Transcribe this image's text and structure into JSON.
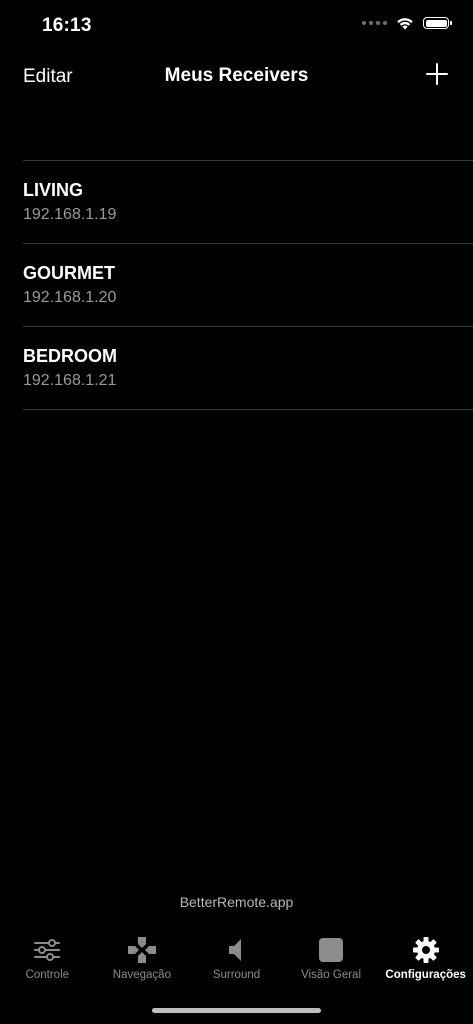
{
  "status_bar": {
    "time": "16:13"
  },
  "nav": {
    "edit_label": "Editar",
    "title": "Meus Receivers",
    "add_icon": "plus-icon"
  },
  "receivers": [
    {
      "name": "LIVING",
      "ip": "192.168.1.19"
    },
    {
      "name": "GOURMET",
      "ip": "192.168.1.20"
    },
    {
      "name": "BEDROOM",
      "ip": "192.168.1.21"
    }
  ],
  "footer": {
    "brand": "BetterRemote.app"
  },
  "tabs": [
    {
      "label": "Controle",
      "icon": "sliders-icon",
      "active": false
    },
    {
      "label": "Navegação",
      "icon": "dpad-icon",
      "active": false
    },
    {
      "label": "Surround",
      "icon": "speaker-icon",
      "active": false
    },
    {
      "label": "Visão Geral",
      "icon": "square-icon",
      "active": false
    },
    {
      "label": "Configurações",
      "icon": "gear-icon",
      "active": true
    }
  ],
  "colors": {
    "background": "#000000",
    "separator": "#3a3a3c",
    "secondary_text": "#9a9a9e",
    "inactive_tab": "#8c8c8c"
  }
}
